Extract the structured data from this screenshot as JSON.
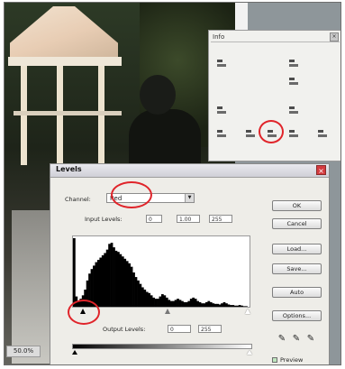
{
  "palette": {
    "tab_label": "Info",
    "close_glyph": "×"
  },
  "levels": {
    "title": "Levels",
    "close_glyph": "×",
    "channel_label": "Channel:",
    "channel_value": "Red",
    "input_levels_label": "Input Levels:",
    "input_levels": [
      "0",
      "1.00",
      "255"
    ],
    "output_levels_label": "Output Levels:",
    "output_levels": [
      "0",
      "255"
    ],
    "buttons": {
      "ok": "OK",
      "cancel": "Cancel",
      "load": "Load...",
      "save": "Save...",
      "auto": "Auto",
      "options": "Options..."
    },
    "preview_label": "Preview",
    "preview_checked": true
  },
  "document": {
    "zoom_status": "50.0%"
  },
  "highlight_color": "#e0242a",
  "histogram": {
    "values": [
      120,
      18,
      10,
      14,
      20,
      30,
      46,
      58,
      66,
      72,
      78,
      82,
      86,
      90,
      94,
      100,
      110,
      112,
      104,
      98,
      96,
      92,
      88,
      84,
      80,
      76,
      70,
      60,
      52,
      46,
      40,
      34,
      30,
      26,
      24,
      20,
      16,
      14,
      14,
      18,
      22,
      20,
      16,
      12,
      10,
      10,
      12,
      14,
      12,
      10,
      8,
      8,
      10,
      14,
      16,
      14,
      10,
      8,
      6,
      6,
      8,
      10,
      8,
      6,
      5,
      5,
      4,
      6,
      8,
      6,
      4,
      3,
      3,
      2,
      2,
      3,
      2,
      1,
      1,
      0
    ]
  },
  "icons": {
    "picker_black": "eyedropper-black-icon",
    "picker_gray": "eyedropper-gray-icon",
    "picker_white": "eyedropper-white-icon"
  }
}
